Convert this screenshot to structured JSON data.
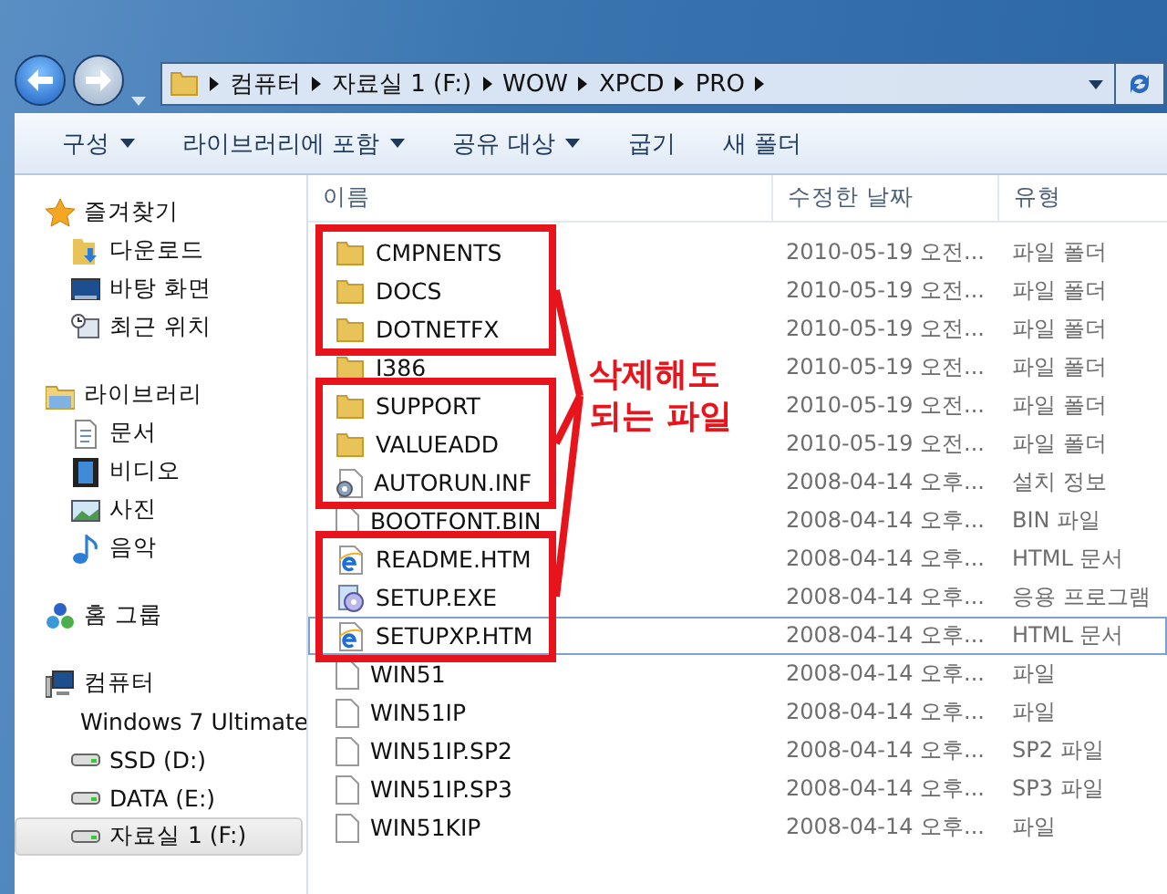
{
  "address_bar": {
    "breadcrumbs": [
      "컴퓨터",
      "자료실 1 (F:)",
      "WOW",
      "XPCD",
      "PRO"
    ]
  },
  "toolbar": [
    {
      "label": "구성",
      "has_menu": true
    },
    {
      "label": "라이브러리에 포함",
      "has_menu": true
    },
    {
      "label": "공유 대상",
      "has_menu": true
    },
    {
      "label": "굽기",
      "has_menu": false
    },
    {
      "label": "새 폴더",
      "has_menu": false
    }
  ],
  "sidebar": {
    "groups": [
      {
        "label": "즐겨찾기",
        "kind": "star",
        "children": [
          {
            "label": "다운로드",
            "kind": "download",
            "selected": false
          },
          {
            "label": "바탕 화면",
            "kind": "desktop",
            "selected": false
          },
          {
            "label": "최근 위치",
            "kind": "recent",
            "selected": false
          }
        ]
      },
      {
        "label": "라이브러리",
        "kind": "library",
        "children": [
          {
            "label": "문서",
            "kind": "document",
            "selected": false
          },
          {
            "label": "비디오",
            "kind": "video",
            "selected": false
          },
          {
            "label": "사진",
            "kind": "picture",
            "selected": false
          },
          {
            "label": "음악",
            "kind": "music",
            "selected": false
          }
        ]
      },
      {
        "label": "홈 그룹",
        "kind": "homegroup"
      },
      {
        "label": "컴퓨터",
        "kind": "computer",
        "children": [
          {
            "label": "Windows 7 Ultimate",
            "kind": "drive",
            "selected": false
          },
          {
            "label": "SSD (D:)",
            "kind": "drive",
            "selected": false
          },
          {
            "label": "DATA (E:)",
            "kind": "drive",
            "selected": false
          },
          {
            "label": "자료실 1 (F:)",
            "kind": "drive",
            "selected": true
          }
        ]
      }
    ]
  },
  "files": {
    "columns": [
      "이름",
      "수정한 날짜",
      "유형"
    ],
    "rows": [
      {
        "name": "CMPNENTS",
        "date": "2010-05-19 오전...",
        "type": "파일 폴더",
        "kind": "folder",
        "focused": false,
        "marked": true
      },
      {
        "name": "DOCS",
        "date": "2010-05-19 오전...",
        "type": "파일 폴더",
        "kind": "folder",
        "focused": false,
        "marked": true
      },
      {
        "name": "DOTNETFX",
        "date": "2010-05-19 오전...",
        "type": "파일 폴더",
        "kind": "folder",
        "focused": false,
        "marked": true
      },
      {
        "name": "I386",
        "date": "2010-05-19 오전...",
        "type": "파일 폴더",
        "kind": "folder",
        "focused": false,
        "marked": false
      },
      {
        "name": "SUPPORT",
        "date": "2010-05-19 오전...",
        "type": "파일 폴더",
        "kind": "folder",
        "focused": false,
        "marked": true
      },
      {
        "name": "VALUEADD",
        "date": "2010-05-19 오전...",
        "type": "파일 폴더",
        "kind": "folder",
        "focused": false,
        "marked": true
      },
      {
        "name": "AUTORUN.INF",
        "date": "2008-04-14 오후...",
        "type": "설치 정보",
        "kind": "config",
        "focused": false,
        "marked": true
      },
      {
        "name": "BOOTFONT.BIN",
        "date": "2008-04-14 오후...",
        "type": "BIN 파일",
        "kind": "file",
        "focused": false,
        "marked": false
      },
      {
        "name": "README.HTM",
        "date": "2008-04-14 오후...",
        "type": "HTML 문서",
        "kind": "web",
        "focused": false,
        "marked": true
      },
      {
        "name": "SETUP.EXE",
        "date": "2008-04-14 오후...",
        "type": "응용 프로그램",
        "kind": "setup",
        "focused": false,
        "marked": true
      },
      {
        "name": "SETUPXP.HTM",
        "date": "2008-04-14 오후...",
        "type": "HTML 문서",
        "kind": "web",
        "focused": true,
        "marked": true
      },
      {
        "name": "WIN51",
        "date": "2008-04-14 오후...",
        "type": "파일",
        "kind": "file",
        "focused": false,
        "marked": false
      },
      {
        "name": "WIN51IP",
        "date": "2008-04-14 오후...",
        "type": "파일",
        "kind": "file",
        "focused": false,
        "marked": false
      },
      {
        "name": "WIN51IP.SP2",
        "date": "2008-04-14 오후...",
        "type": "SP2 파일",
        "kind": "file",
        "focused": false,
        "marked": false
      },
      {
        "name": "WIN51IP.SP3",
        "date": "2008-04-14 오후...",
        "type": "SP3 파일",
        "kind": "file",
        "focused": false,
        "marked": false
      },
      {
        "name": "WIN51KIP",
        "date": "2008-04-14 오후...",
        "type": "파일",
        "kind": "file",
        "focused": false,
        "marked": false
      }
    ]
  },
  "annotation": {
    "label": "삭제해도 되는 파일"
  }
}
